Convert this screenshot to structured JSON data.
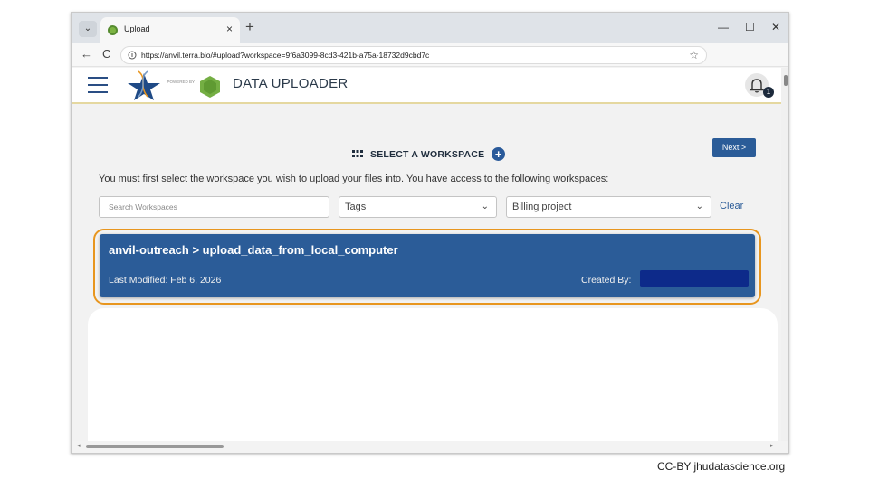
{
  "browser": {
    "tab_title": "Upload",
    "tab_close": "×",
    "new_tab": "+",
    "tab_dropdown": "⌄",
    "url": "https://anvil.terra.bio/#upload?workspace=9f6a3099-8cd3-421b-a75a-18732d9cbd7c",
    "back": "←",
    "reload": "C",
    "bookmark": "☆",
    "minimize": "—",
    "maximize": "☐",
    "close": "✕"
  },
  "header": {
    "powered_by": "POWERED BY",
    "terra_badge": "Terra",
    "title": "DATA UPLOADER",
    "notification_count": "1"
  },
  "main": {
    "section_title": "SELECT A WORKSPACE",
    "next_label": "Next >",
    "instructions": "You must first select the workspace you wish to upload your files into. You have access to the following workspaces:",
    "search_placeholder": "Search Workspaces",
    "tags_label": "Tags",
    "billing_label": "Billing project",
    "clear_label": "Clear",
    "workspace": {
      "name": "anvil-outreach > upload_data_from_local_computer",
      "last_modified": "Last Modified: Feb 6, 2026",
      "created_by": "Created By:"
    }
  },
  "footer": {
    "credit": "CC-BY  jhudatascience.org"
  },
  "colors": {
    "primary": "#2b5c98",
    "highlight": "#e8961f",
    "redaction": "#0d2a8a"
  }
}
